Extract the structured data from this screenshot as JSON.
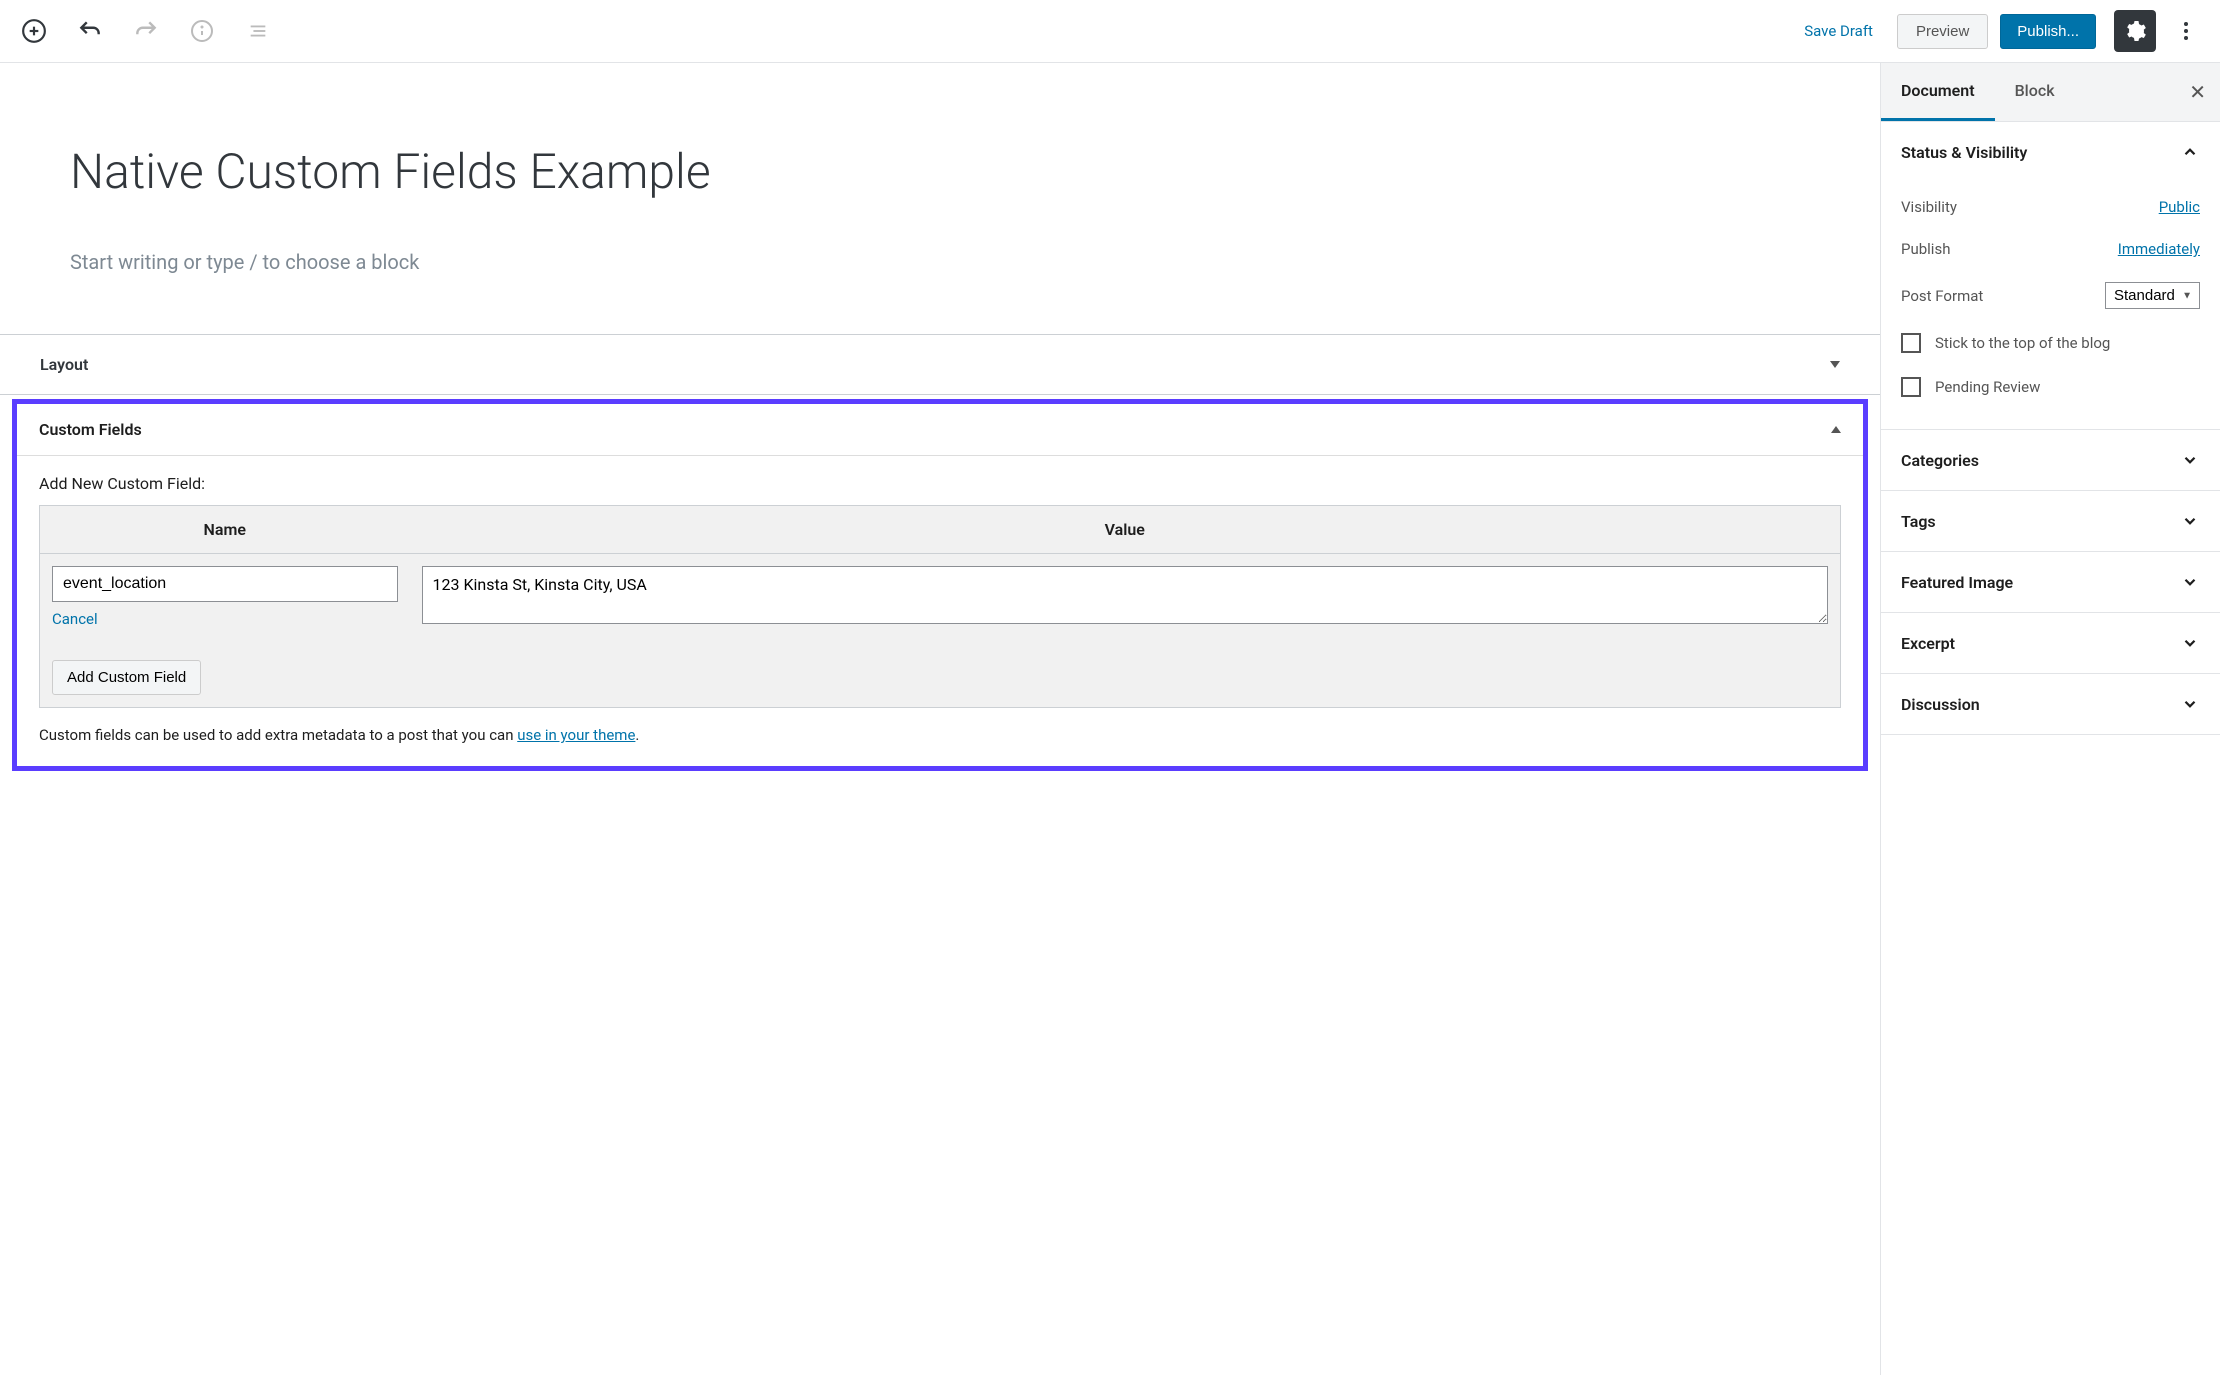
{
  "toolbar": {
    "save_draft": "Save Draft",
    "preview": "Preview",
    "publish": "Publish..."
  },
  "post": {
    "title": "Native Custom Fields Example",
    "placeholder": "Start writing or type / to choose a block"
  },
  "layout_panel": {
    "title": "Layout"
  },
  "custom_fields": {
    "title": "Custom Fields",
    "subtitle": "Add New Custom Field:",
    "col_name": "Name",
    "col_value": "Value",
    "name_value": "event_location",
    "value_value": "123 Kinsta St, Kinsta City, USA",
    "cancel": "Cancel",
    "add_button": "Add Custom Field",
    "note_prefix": "Custom fields can be used to add extra metadata to a post that you can ",
    "note_link": "use in your theme",
    "note_suffix": "."
  },
  "sidebar": {
    "tabs": {
      "document": "Document",
      "block": "Block"
    },
    "status": {
      "title": "Status & Visibility",
      "visibility_label": "Visibility",
      "visibility_value": "Public",
      "publish_label": "Publish",
      "publish_value": "Immediately",
      "format_label": "Post Format",
      "format_value": "Standard",
      "stick": "Stick to the top of the blog",
      "pending": "Pending Review"
    },
    "panels": {
      "categories": "Categories",
      "tags": "Tags",
      "featured_image": "Featured Image",
      "excerpt": "Excerpt",
      "discussion": "Discussion"
    }
  }
}
